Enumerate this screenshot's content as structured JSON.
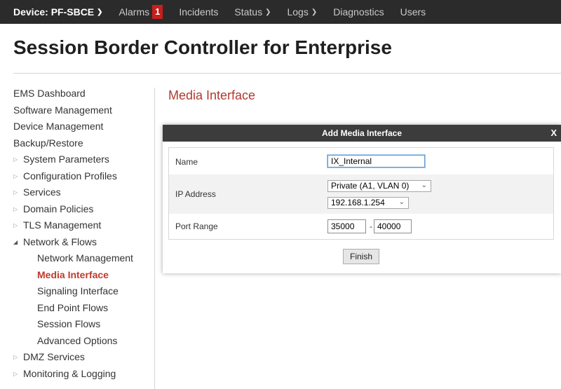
{
  "topnav": {
    "device": "Device: PF-SBCE",
    "alarms": "Alarms",
    "alarm_count": "1",
    "incidents": "Incidents",
    "status": "Status",
    "logs": "Logs",
    "diagnostics": "Diagnostics",
    "users": "Users"
  },
  "page_title": "Session Border Controller for Enterprise",
  "sidebar": {
    "items": [
      {
        "label": "EMS Dashboard"
      },
      {
        "label": "Software Management"
      },
      {
        "label": "Device Management"
      },
      {
        "label": "Backup/Restore"
      },
      {
        "label": "System Parameters"
      },
      {
        "label": "Configuration Profiles"
      },
      {
        "label": "Services"
      },
      {
        "label": "Domain Policies"
      },
      {
        "label": "TLS Management"
      },
      {
        "label": "Network & Flows"
      },
      {
        "label": "Network Management"
      },
      {
        "label": "Media Interface"
      },
      {
        "label": "Signaling Interface"
      },
      {
        "label": "End Point Flows"
      },
      {
        "label": "Session Flows"
      },
      {
        "label": "Advanced Options"
      },
      {
        "label": "DMZ Services"
      },
      {
        "label": "Monitoring & Logging"
      }
    ]
  },
  "main": {
    "title": "Media Interface"
  },
  "modal": {
    "title": "Add Media Interface",
    "close": "X",
    "name_label": "Name",
    "name_value": "IX_Internal",
    "ip_label": "IP Address",
    "ip_network": "Private (A1, VLAN 0)",
    "ip_address": "192.168.1.254",
    "port_label": "Port Range",
    "port_start": "35000",
    "port_dash": "-",
    "port_end": "40000",
    "finish": "Finish"
  }
}
